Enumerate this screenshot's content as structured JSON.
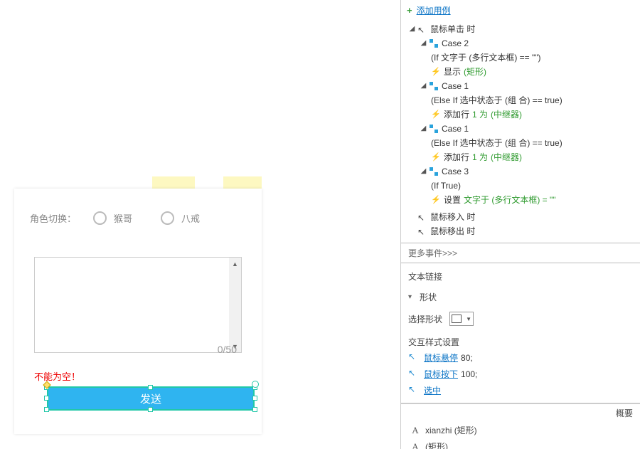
{
  "canvas": {
    "role_label": "角色切换：",
    "role_options": [
      "猴哥",
      "八戒"
    ],
    "counter": "0/50",
    "error": "不能为空！",
    "send_label": "发送"
  },
  "panel": {
    "add_case": "添加用例",
    "events": {
      "click": {
        "label": "鼠标单击 时",
        "cases": [
          {
            "name": "Case 2",
            "condition": "(If 文字于 (多行文本框) == \"\")",
            "action_prefix": "显示",
            "action_target": "(矩形)"
          },
          {
            "name": "Case 1",
            "condition": "(Else If 选中状态于 (组 合) == true)",
            "action_prefix": "添加行",
            "action_value": "1 为",
            "action_target": "(中继器)"
          },
          {
            "name": "Case 1",
            "condition": "(Else If 选中状态于 (组 合) == true)",
            "action_prefix": "添加行",
            "action_value": "1 为",
            "action_target": "(中继器)"
          },
          {
            "name": "Case 3",
            "condition": "(If True)",
            "action_prefix": "设置",
            "action_target": "文字于 (多行文本框) = \"\""
          }
        ]
      },
      "mouse_in": "鼠标移入 时",
      "mouse_out": "鼠标移出 时"
    },
    "more_events": "更多事件>>>",
    "text_link": "文本链接",
    "shape_section": "形状",
    "shape_label": "选择形状",
    "style_title": "交互样式设置",
    "styles": [
      {
        "label": "鼠标悬停",
        "value": "80;"
      },
      {
        "label": "鼠标按下",
        "value": "100;"
      },
      {
        "label": "选中",
        "value": ""
      }
    ],
    "outline_header": "概要",
    "outline_items": [
      "xianzhi (矩形)",
      "(矩形)"
    ]
  }
}
